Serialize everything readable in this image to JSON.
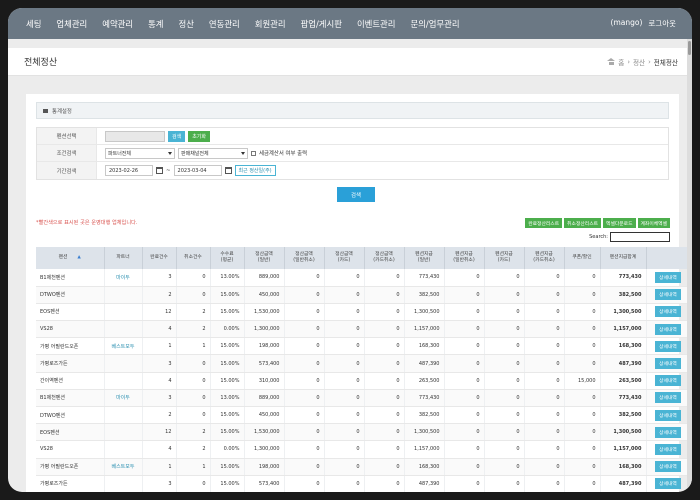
{
  "nav": {
    "items": [
      "세팅",
      "업체관리",
      "예약관리",
      "통계",
      "정산",
      "연동관리",
      "회원관리",
      "팝업/게시판",
      "이벤트관리",
      "문의/업무관리"
    ],
    "user": "(mango)",
    "logout": "로그아웃"
  },
  "page": {
    "title": "전체정산",
    "breadcrumb": [
      "홈",
      "정산",
      "전체정산"
    ]
  },
  "panel": {
    "title": "통계설정",
    "rows": {
      "pension_label": "펜션선택",
      "condition_label": "조건검색",
      "period_label": "기간검색"
    },
    "search_btn": "검색",
    "reset_btn": "초기화",
    "partner_select": "파트너전체",
    "channel_select": "판매채널전체",
    "tax_check_label": "세금계산서 여부 출력",
    "date_from": "2023-02-26",
    "tilde": "~",
    "date_to": "2023-03-04",
    "recent_btn": "최근 정산일(주)",
    "main_search_btn": "검색"
  },
  "note": "*빨간색으로 표시된 곳은 운영대행 업체입니다.",
  "actions": [
    "완료정산리스트",
    "취소정산리스트",
    "엑셀다운로드",
    "계좌이체엑셀"
  ],
  "table_search_label": "Search:",
  "table": {
    "headers": [
      "펜션",
      "파트너",
      "완료건수",
      "취소건수",
      "수수료\n(평균)",
      "정산금액\n(일반)",
      "정산금액\n(일반취소)",
      "정산금액\n(카드)",
      "정산금액\n(카드취소)",
      "펜션지급\n(일반)",
      "펜션지급\n(일반취소)",
      "펜션지급\n(카드)",
      "펜션지급\n(카드취소)",
      "쿠폰/할인",
      "펜션지급합계",
      ""
    ],
    "rows": [
      [
        "B1제천펜션",
        "마이두",
        "3",
        "0",
        "13.00%",
        "889,000",
        "0",
        "0",
        "0",
        "773,430",
        "0",
        "0",
        "0",
        "0",
        "773,430"
      ],
      [
        "DTWO펜션",
        "",
        "2",
        "0",
        "15.00%",
        "450,000",
        "0",
        "0",
        "0",
        "382,500",
        "0",
        "0",
        "0",
        "0",
        "382,500"
      ],
      [
        "EOS펜션",
        "",
        "12",
        "2",
        "15.00%",
        "1,530,000",
        "0",
        "0",
        "0",
        "1,300,500",
        "0",
        "0",
        "0",
        "0",
        "1,300,500"
      ],
      [
        "VS28",
        "",
        "4",
        "2",
        "0.00%",
        "1,300,000",
        "0",
        "0",
        "0",
        "1,157,000",
        "0",
        "0",
        "0",
        "0",
        "1,157,000"
      ],
      [
        "가평 어필란드오픈",
        "베스트모두",
        "1",
        "1",
        "15.00%",
        "198,000",
        "0",
        "0",
        "0",
        "168,300",
        "0",
        "0",
        "0",
        "0",
        "168,300"
      ],
      [
        "가평로즈가든",
        "",
        "3",
        "0",
        "15.00%",
        "573,400",
        "0",
        "0",
        "0",
        "487,390",
        "0",
        "0",
        "0",
        "0",
        "487,390"
      ],
      [
        "간이역펜션",
        "",
        "4",
        "0",
        "15.00%",
        "310,000",
        "0",
        "0",
        "0",
        "263,500",
        "0",
        "0",
        "0",
        "15,000",
        "263,500"
      ],
      [
        "B1제천펜션",
        "마이두",
        "3",
        "0",
        "13.00%",
        "889,000",
        "0",
        "0",
        "0",
        "773,430",
        "0",
        "0",
        "0",
        "0",
        "773,430"
      ],
      [
        "DTWO펜션",
        "",
        "2",
        "0",
        "15.00%",
        "450,000",
        "0",
        "0",
        "0",
        "382,500",
        "0",
        "0",
        "0",
        "0",
        "382,500"
      ],
      [
        "EOS펜션",
        "",
        "12",
        "2",
        "15.00%",
        "1,530,000",
        "0",
        "0",
        "0",
        "1,300,500",
        "0",
        "0",
        "0",
        "0",
        "1,300,500"
      ],
      [
        "VS28",
        "",
        "4",
        "2",
        "0.00%",
        "1,300,000",
        "0",
        "0",
        "0",
        "1,157,000",
        "0",
        "0",
        "0",
        "0",
        "1,157,000"
      ],
      [
        "가평 어필란드오픈",
        "베스트모두",
        "1",
        "1",
        "15.00%",
        "198,000",
        "0",
        "0",
        "0",
        "168,300",
        "0",
        "0",
        "0",
        "0",
        "168,300"
      ],
      [
        "가평로즈가든",
        "",
        "3",
        "0",
        "15.00%",
        "573,400",
        "0",
        "0",
        "0",
        "487,390",
        "0",
        "0",
        "0",
        "0",
        "487,390"
      ]
    ],
    "detail_btn": "상세내역"
  },
  "colors": {
    "nav_bg": "#6b7884",
    "accent": "#4ab4d4",
    "green": "#4cae4c",
    "note": "#d9534f"
  }
}
